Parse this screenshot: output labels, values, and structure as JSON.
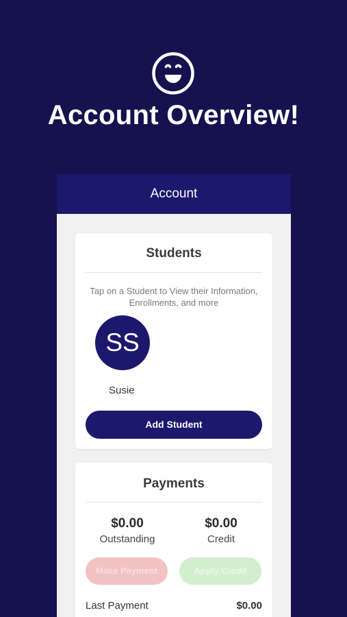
{
  "hero": {
    "icon": "smiley-face-icon",
    "title": "Account Overview!"
  },
  "appbar": {
    "title": "Account"
  },
  "students": {
    "title": "Students",
    "hint": "Tap on a Student to View their Information, Enrollments, and more",
    "items": [
      {
        "initials": "SS",
        "name": "Susie"
      }
    ],
    "add_button_label": "Add Student"
  },
  "payments": {
    "title": "Payments",
    "outstanding": {
      "value": "$0.00",
      "label": "Outstanding"
    },
    "credit": {
      "value": "$0.00",
      "label": "Credit"
    },
    "make_payment_label": "Make Payment",
    "apply_credit_label": "Apply Credit",
    "last_payment": {
      "label": "Last Payment",
      "value": "$0.00"
    }
  },
  "colors": {
    "background": "#16124f",
    "primary": "#1c186e",
    "disabled_red": "#f2c2c2",
    "disabled_green": "#d3eecf"
  }
}
